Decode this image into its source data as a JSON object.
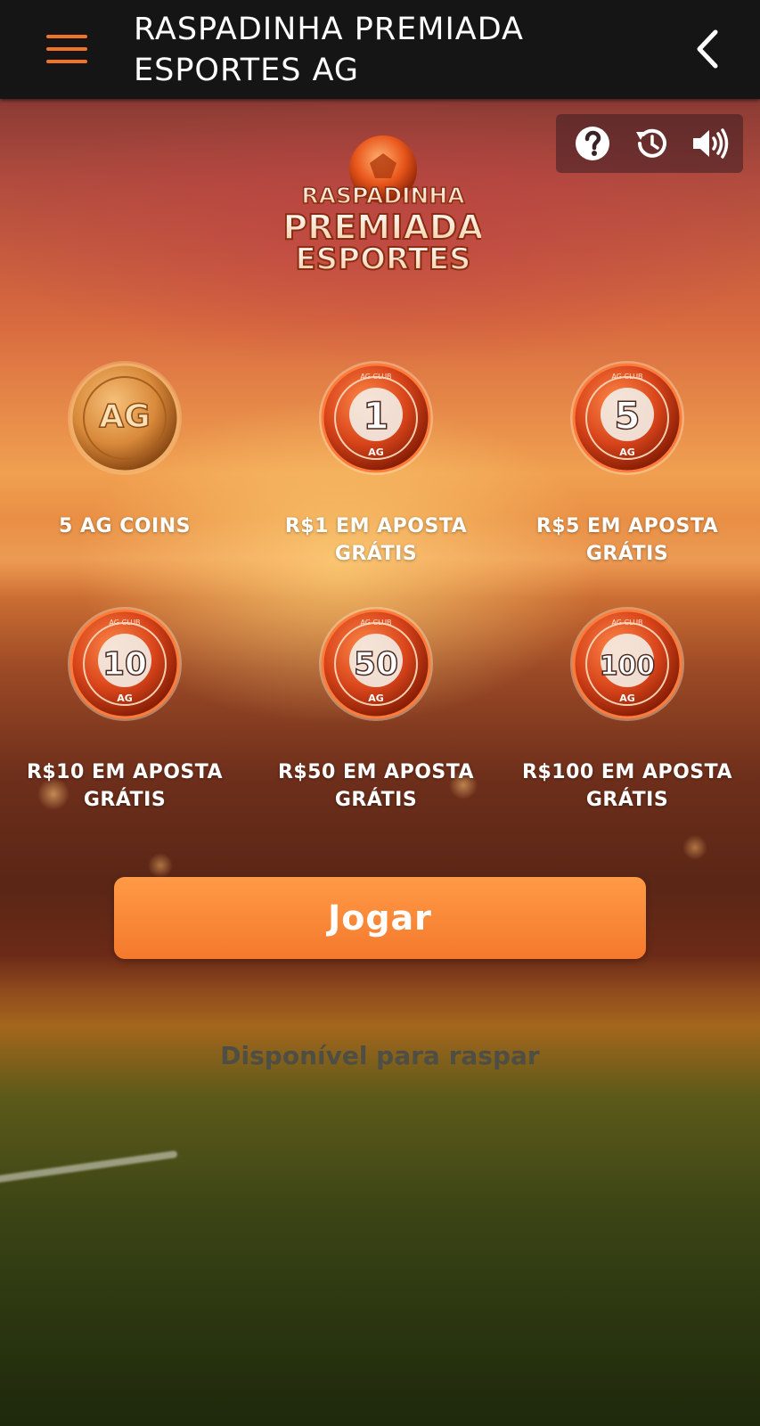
{
  "header": {
    "title": "RASPADINHA PREMIADA ESPORTES AG",
    "menu_icon": "hamburger-menu-icon",
    "back_icon": "chevron-left-icon"
  },
  "toolbar": {
    "help_icon": "question-icon",
    "history_icon": "history-icon",
    "sound_icon": "volume-icon"
  },
  "logo": {
    "line1": "RASPADINHA",
    "line2": "PREMIADA",
    "line3": "ESPORTES"
  },
  "prizes": [
    {
      "coin_text": "AG",
      "coin_type": "gold",
      "label": "5 AG COINS"
    },
    {
      "coin_text": "1",
      "coin_type": "red",
      "label": "R$1 EM APOSTA GRÁTIS"
    },
    {
      "coin_text": "5",
      "coin_type": "red",
      "label": "R$5 EM APOSTA GRÁTIS"
    },
    {
      "coin_text": "10",
      "coin_type": "red",
      "label": "R$10 EM APOSTA GRÁTIS"
    },
    {
      "coin_text": "50",
      "coin_type": "red",
      "label": "R$50 EM APOSTA GRÁTIS"
    },
    {
      "coin_text": "100",
      "coin_type": "red",
      "label": "R$100 EM APOSTA GRÁTIS"
    }
  ],
  "coin_ring_text": "AG CLUB",
  "coin_badge": "AG",
  "play_button": {
    "label": "Jogar"
  },
  "status": {
    "text": "Disponível para raspar"
  },
  "colors": {
    "accent": "#f0732a",
    "header_bg": "#151515",
    "button": "#f7843a",
    "coin_red": "#d8441a",
    "coin_gold": "#d98a3a"
  }
}
